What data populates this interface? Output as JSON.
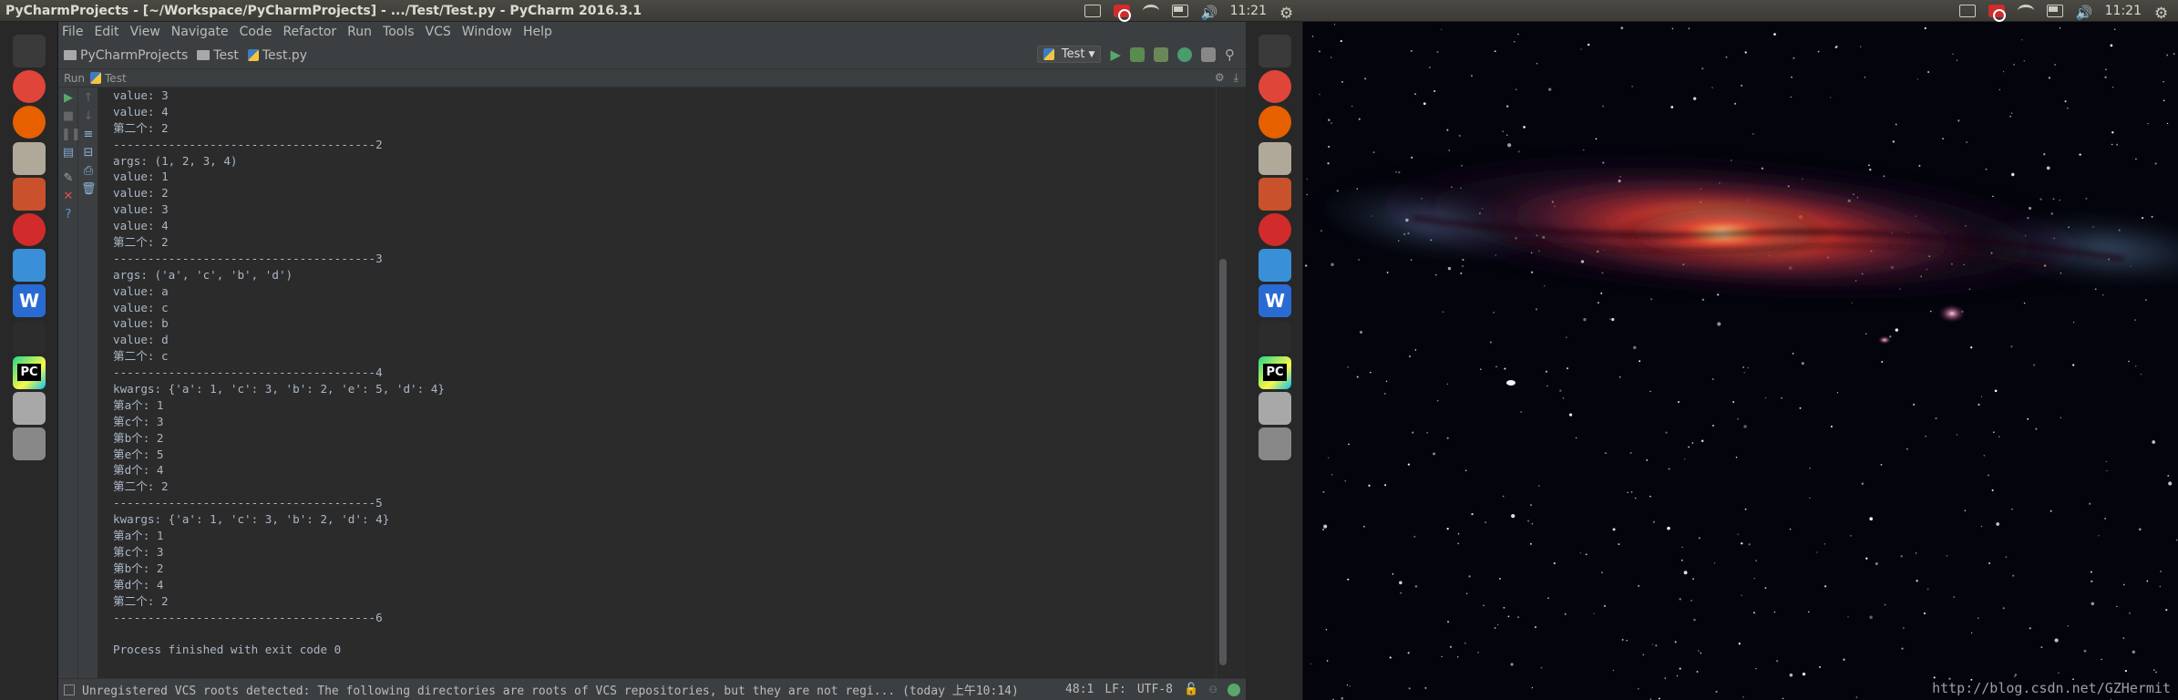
{
  "screen1": {
    "window_title": "PyCharmProjects - [~/Workspace/PyCharmProjects] - .../Test/Test.py - PyCharm 2016.3.1",
    "tray": {
      "time": "11:21",
      "icons": [
        "keyboard-icon",
        "netease-music-icon",
        "wifi-icon",
        "battery-icon",
        "volume-icon",
        "gear-icon"
      ]
    }
  },
  "screen2": {
    "tray": {
      "time": "11:21"
    },
    "watermark": "http://blog.csdn.net/GZHermit"
  },
  "launcher": {
    "items": [
      {
        "name": "ubuntu-dash",
        "color": "#3a3a3a"
      },
      {
        "name": "chrome",
        "color": "#e0453a"
      },
      {
        "name": "firefox",
        "color": "#e66000"
      },
      {
        "name": "files",
        "color": "#b0a99a"
      },
      {
        "name": "settings",
        "color": "#c9522c"
      },
      {
        "name": "netease-music",
        "color": "#d12b2b"
      },
      {
        "name": "sogou",
        "color": "#3a8fd9"
      },
      {
        "name": "wps",
        "color": "#2a6bd3"
      },
      {
        "name": "terminal",
        "color": "#2c2c2c"
      },
      {
        "name": "pycharm",
        "color": "#21d789"
      },
      {
        "name": "disk",
        "color": "#a8a8a8"
      },
      {
        "name": "trash",
        "color": "#888888"
      }
    ],
    "pycharm_label": "PC",
    "wps_label": "W"
  },
  "menu": [
    "File",
    "Edit",
    "View",
    "Navigate",
    "Code",
    "Refactor",
    "Run",
    "Tools",
    "VCS",
    "Window",
    "Help"
  ],
  "nav": {
    "crumbs": [
      "PyCharmProjects",
      "Test",
      "Test.py"
    ],
    "run_config": "Test"
  },
  "runbar": {
    "run_label": "Run",
    "config": "Test"
  },
  "console_lines": [
    "value: 3",
    "value: 4",
    "第二个: 2",
    "--------------------------------------2",
    "args: (1, 2, 3, 4)",
    "value: 1",
    "value: 2",
    "value: 3",
    "value: 4",
    "第二个: 2",
    "--------------------------------------3",
    "args: ('a', 'c', 'b', 'd')",
    "value: a",
    "value: c",
    "value: b",
    "value: d",
    "第二个: c",
    "--------------------------------------4",
    "kwargs: {'a': 1, 'c': 3, 'b': 2, 'e': 5, 'd': 4}",
    "第a个: 1",
    "第c个: 3",
    "第b个: 2",
    "第e个: 5",
    "第d个: 4",
    "第二个: 2",
    "--------------------------------------5",
    "kwargs: {'a': 1, 'c': 3, 'b': 2, 'd': 4}",
    "第a个: 1",
    "第c个: 3",
    "第b个: 2",
    "第d个: 4",
    "第二个: 2",
    "--------------------------------------6",
    "",
    "Process finished with exit code 0"
  ],
  "status": {
    "message": "Unregistered VCS roots detected: The following directories are roots of VCS repositories, but they are not regi... (today 上午10:14)",
    "position": "48:1",
    "line_sep": "LF:",
    "encoding": "UTF-8"
  }
}
